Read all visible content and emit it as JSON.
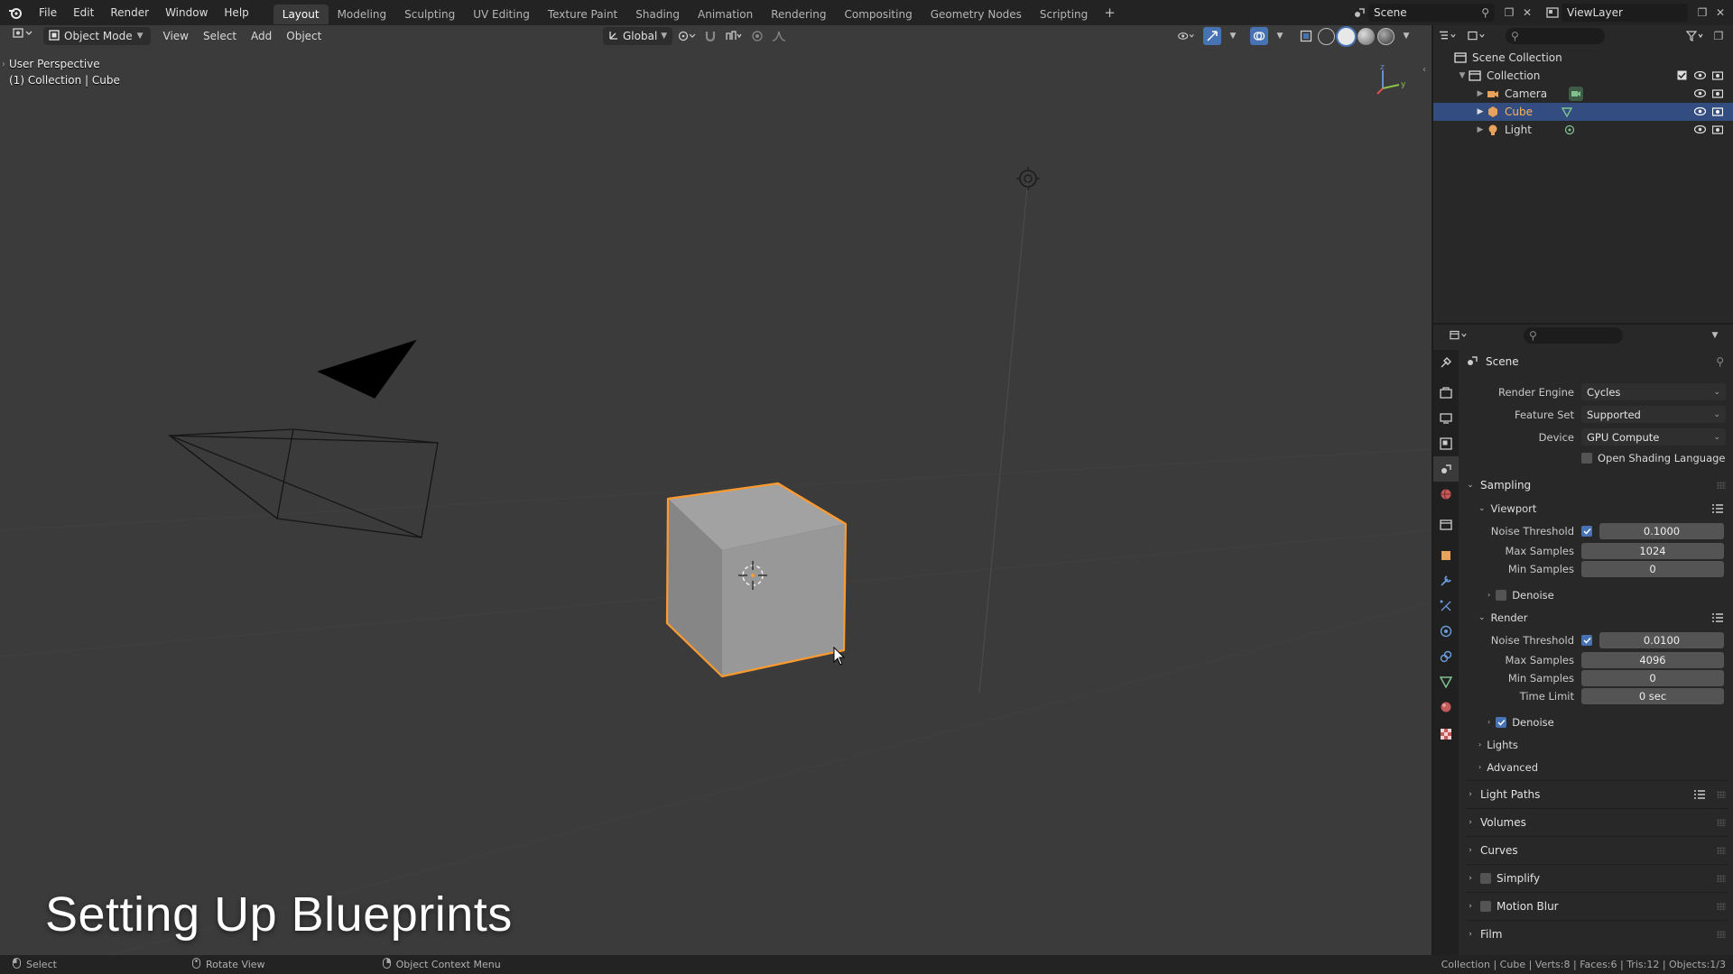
{
  "topbar": {
    "menus": [
      "File",
      "Edit",
      "Render",
      "Window",
      "Help"
    ],
    "workspaces": [
      "Layout",
      "Modeling",
      "Sculpting",
      "UV Editing",
      "Texture Paint",
      "Shading",
      "Animation",
      "Rendering",
      "Compositing",
      "Geometry Nodes",
      "Scripting"
    ],
    "active_workspace": "Layout",
    "add_tab": "+",
    "scene_name": "Scene",
    "view_layer": "ViewLayer"
  },
  "viewport": {
    "mode": "Object Mode",
    "menus": [
      "View",
      "Select",
      "Add",
      "Object"
    ],
    "transform_orientation": "Global",
    "perspective_label": "User Perspective",
    "collection_label": "(1) Collection | Cube",
    "overlay_title": "Setting Up Blueprints",
    "gizmo_axes": {
      "x": "x",
      "y": "y",
      "z": "z"
    },
    "colors": {
      "selection_outline": "#ff9a2e",
      "background": "#3b3b3b"
    }
  },
  "statusbar": {
    "left": [
      {
        "icon": "mouse-left-icon",
        "label": "Select"
      },
      {
        "icon": "mouse-middle-icon",
        "label": "Rotate View"
      },
      {
        "icon": "mouse-right-icon",
        "label": "Object Context Menu"
      }
    ],
    "right": "Collection | Cube | Verts:8 | Faces:6 | Tris:12 | Objects:1/3"
  },
  "outliner": {
    "root": "Scene Collection",
    "collection": "Collection",
    "items": [
      {
        "label": "Camera",
        "icon": "camera-icon",
        "selected": false
      },
      {
        "label": "Cube",
        "icon": "mesh-icon",
        "selected": true
      },
      {
        "label": "Light",
        "icon": "light-icon",
        "selected": false
      }
    ]
  },
  "properties": {
    "context": "Scene",
    "render_engine_label": "Render Engine",
    "render_engine": "Cycles",
    "feature_set_label": "Feature Set",
    "feature_set": "Supported",
    "device_label": "Device",
    "device": "GPU Compute",
    "osl_label": "Open Shading Language",
    "sampling": {
      "title": "Sampling",
      "viewport": {
        "title": "Viewport",
        "noise_threshold_label": "Noise Threshold",
        "noise_threshold": "0.1000",
        "max_samples_label": "Max Samples",
        "max_samples": "1024",
        "min_samples_label": "Min Samples",
        "min_samples": "0",
        "denoise_label": "Denoise"
      },
      "render": {
        "title": "Render",
        "noise_threshold_label": "Noise Threshold",
        "noise_threshold": "0.0100",
        "max_samples_label": "Max Samples",
        "max_samples": "4096",
        "min_samples_label": "Min Samples",
        "min_samples": "0",
        "time_limit_label": "Time Limit",
        "time_limit": "0 sec",
        "denoise_label": "Denoise"
      },
      "lights_label": "Lights",
      "advanced_label": "Advanced"
    },
    "sections": [
      "Light Paths",
      "Volumes",
      "Curves",
      "Simplify",
      "Motion Blur",
      "Film"
    ]
  }
}
